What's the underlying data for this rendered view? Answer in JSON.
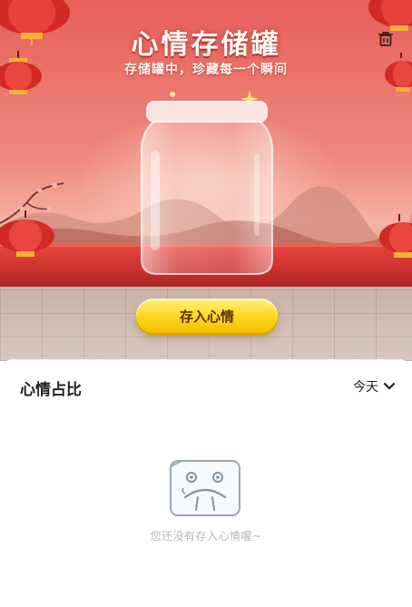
{
  "header": {
    "title": "心情存储罐",
    "subtitle": "存储罐中，珍藏每一个瞬间",
    "delete_icon": "trash-icon"
  },
  "jar": {
    "save_label": "存入心情"
  },
  "panel": {
    "title": "心情占比",
    "period_label": "今天",
    "period_icon": "chevron-down-icon",
    "empty_icon": "sad-box-icon",
    "empty_text": "您还没有存入心情喔~"
  },
  "colors": {
    "accent_red": "#e85f5b",
    "button_yellow": "#ffd51e",
    "button_text": "#5a2d0c"
  }
}
